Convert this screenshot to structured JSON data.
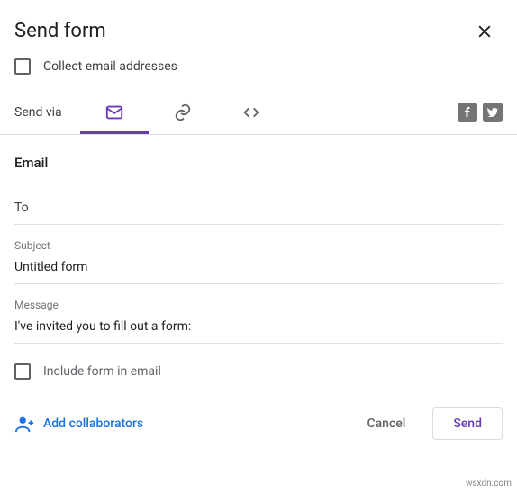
{
  "header": {
    "title": "Send form"
  },
  "collect": {
    "label": "Collect email addresses"
  },
  "sendVia": {
    "label": "Send via"
  },
  "emailSection": {
    "label": "Email",
    "to": {
      "placeholder": "To",
      "value": ""
    },
    "subject": {
      "label": "Subject",
      "value": "Untitled form"
    },
    "message": {
      "label": "Message",
      "value": "I've invited you to fill out a form:"
    },
    "include": {
      "label": "Include form in email"
    }
  },
  "footer": {
    "addCollaborators": "Add collaborators",
    "cancel": "Cancel",
    "send": "Send"
  },
  "watermark": "wsxdn.com"
}
